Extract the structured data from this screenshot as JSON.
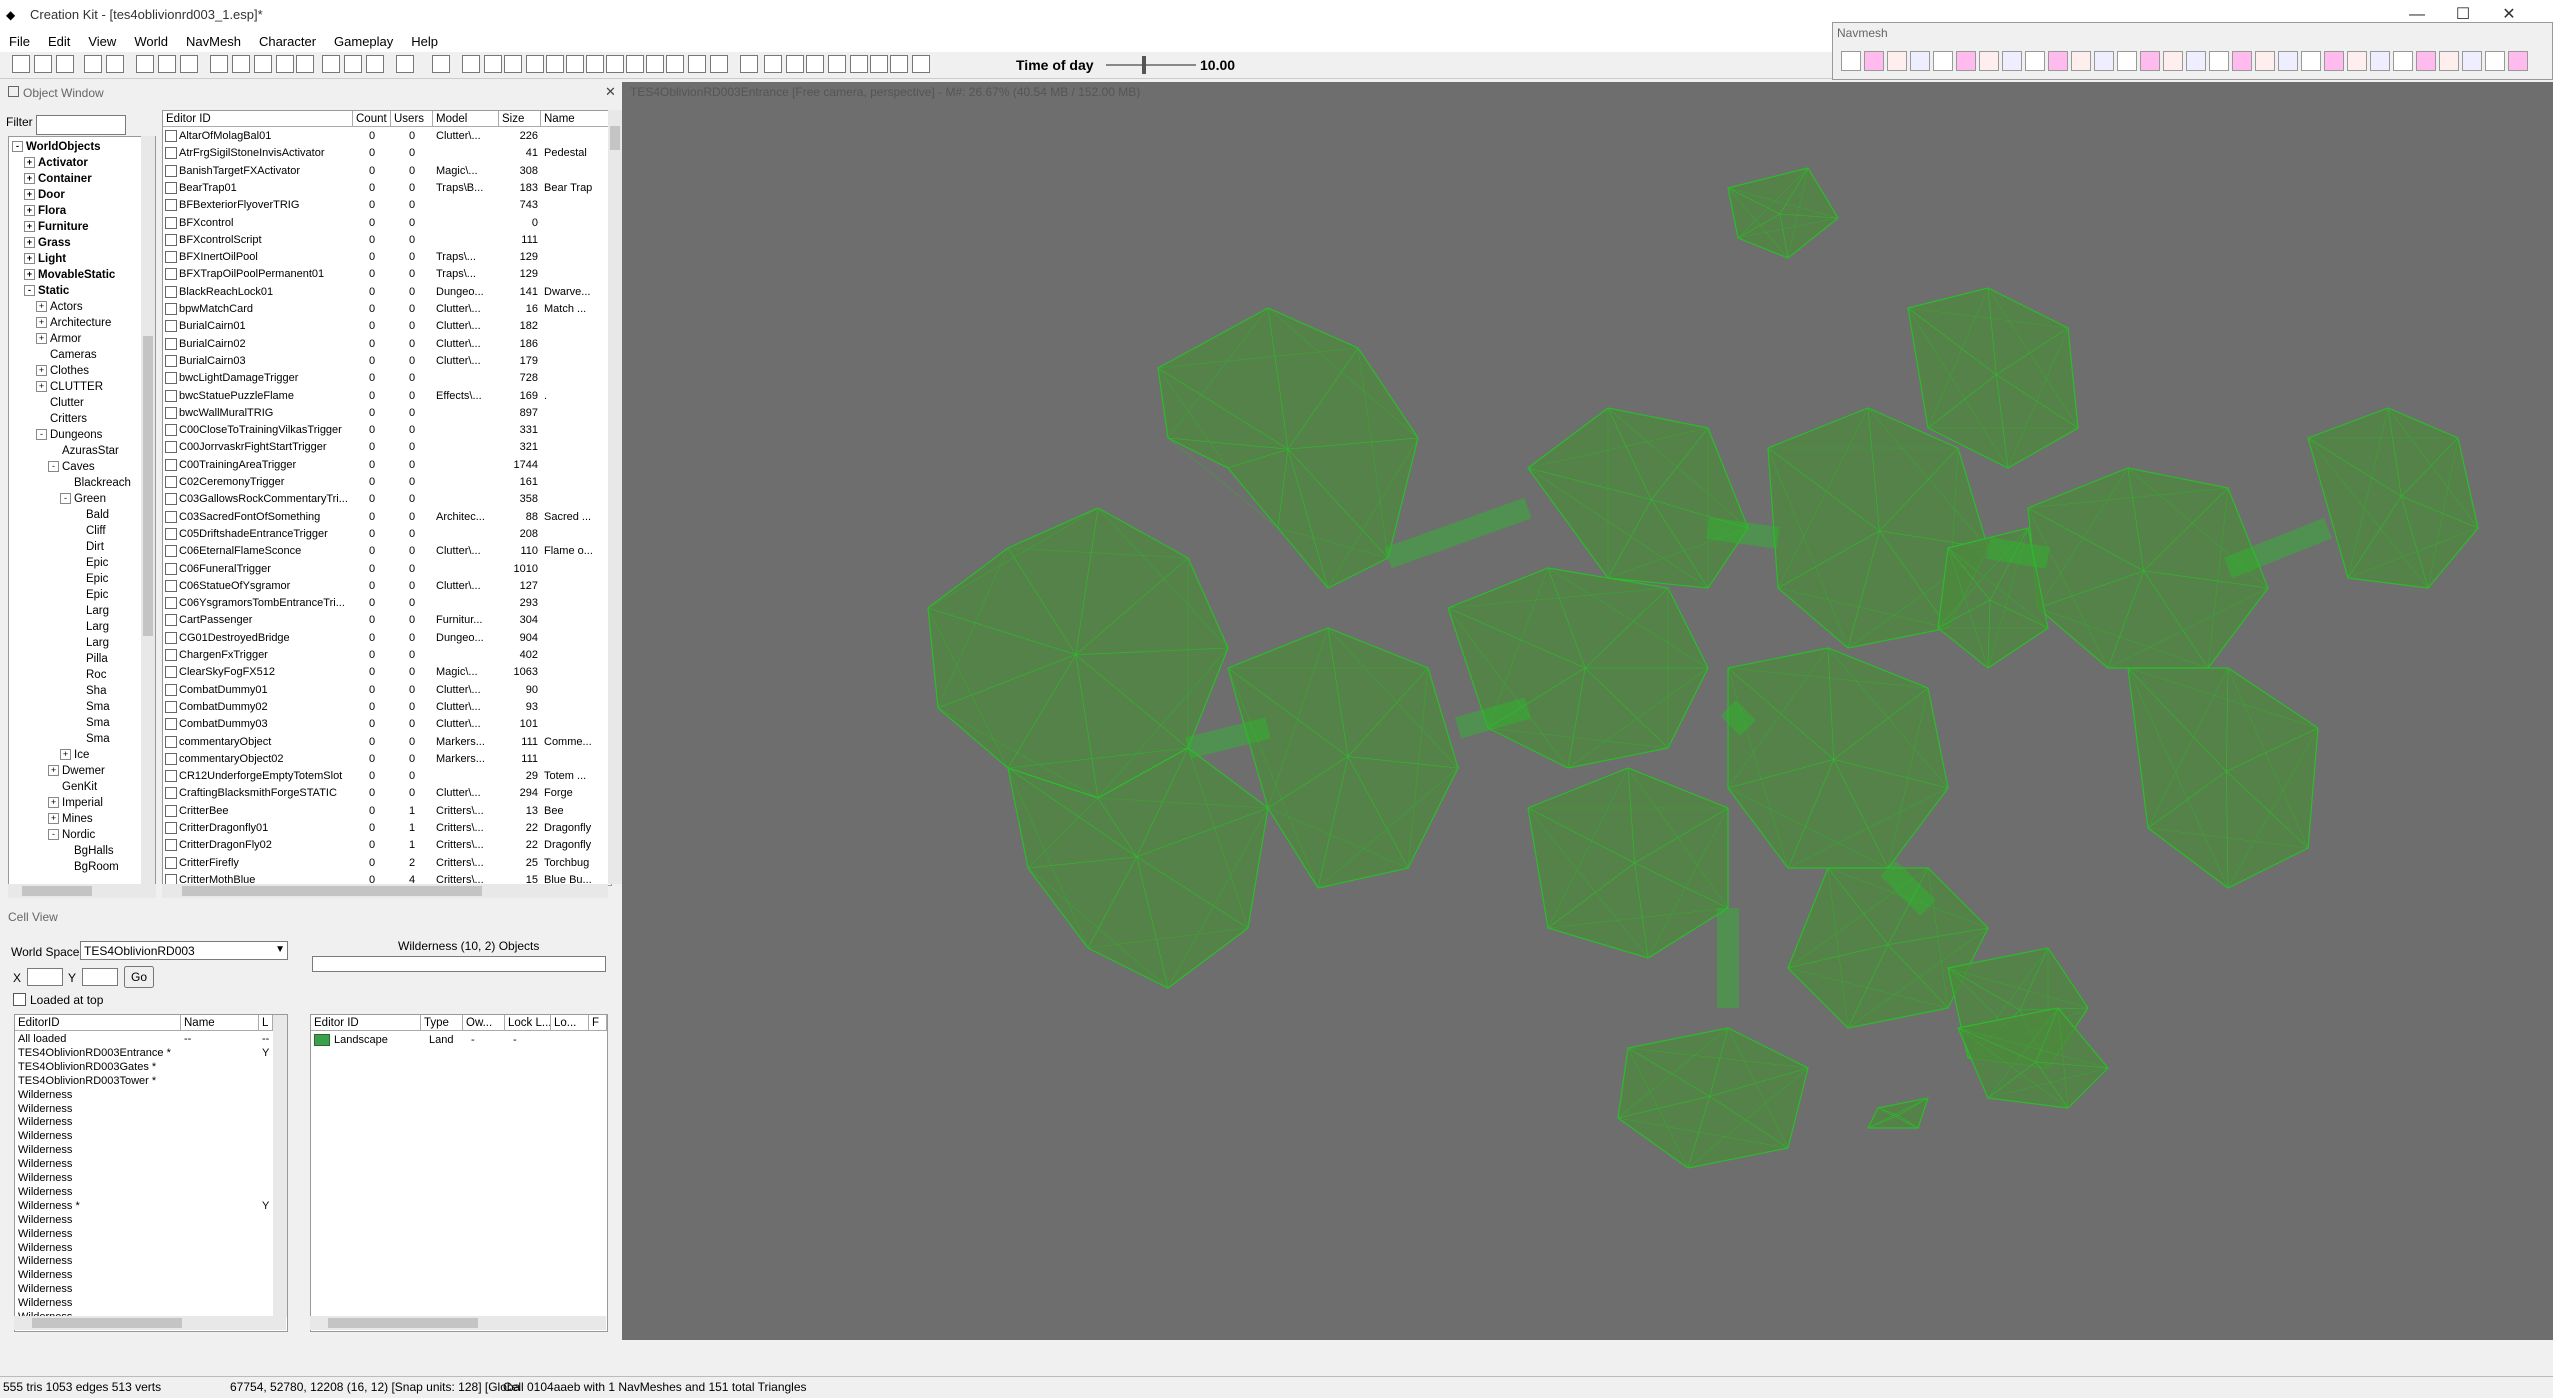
{
  "window": {
    "title": "Creation Kit - [tes4oblivionrd003_1.esp]*",
    "min": "—",
    "max": "☐",
    "close": "✕"
  },
  "menu": [
    "File",
    "Edit",
    "View",
    "World",
    "NavMesh",
    "Character",
    "Gameplay",
    "Help"
  ],
  "toolbar": {
    "time_label": "Time of day",
    "time_value": "10.00",
    "time_fraction": 0.42
  },
  "navmesh_window": {
    "title": "Navmesh"
  },
  "object_window": {
    "title": "Object Window",
    "close": "✕",
    "filter_label": "Filter",
    "tree": [
      {
        "label": "WorldObjects",
        "bold": true,
        "level": 0,
        "exp": "-"
      },
      {
        "label": "Activator",
        "bold": true,
        "level": 1,
        "exp": "+"
      },
      {
        "label": "Container",
        "bold": true,
        "level": 1,
        "exp": "+"
      },
      {
        "label": "Door",
        "bold": true,
        "level": 1,
        "exp": "+"
      },
      {
        "label": "Flora",
        "bold": true,
        "level": 1,
        "exp": "+"
      },
      {
        "label": "Furniture",
        "bold": true,
        "level": 1,
        "exp": "+"
      },
      {
        "label": "Grass",
        "bold": true,
        "level": 1,
        "exp": "+"
      },
      {
        "label": "Light",
        "bold": true,
        "level": 1,
        "exp": "+"
      },
      {
        "label": "MovableStatic",
        "bold": true,
        "level": 1,
        "exp": "+"
      },
      {
        "label": "Static",
        "bold": true,
        "level": 1,
        "exp": "-"
      },
      {
        "label": "Actors",
        "level": 2,
        "exp": "+"
      },
      {
        "label": "Architecture",
        "level": 2,
        "exp": "+"
      },
      {
        "label": "Armor",
        "level": 2,
        "exp": "+"
      },
      {
        "label": "Cameras",
        "level": 2,
        "exp": ""
      },
      {
        "label": "Clothes",
        "level": 2,
        "exp": "+"
      },
      {
        "label": "CLUTTER",
        "level": 2,
        "exp": "+"
      },
      {
        "label": "Clutter",
        "level": 2,
        "exp": ""
      },
      {
        "label": "Critters",
        "level": 2,
        "exp": ""
      },
      {
        "label": "Dungeons",
        "level": 2,
        "exp": "-"
      },
      {
        "label": "AzurasStar",
        "level": 3,
        "exp": ""
      },
      {
        "label": "Caves",
        "level": 3,
        "exp": "-"
      },
      {
        "label": "Blackreach",
        "level": 4,
        "exp": ""
      },
      {
        "label": "Green",
        "level": 4,
        "exp": "-"
      },
      {
        "label": "Bald",
        "level": 5,
        "exp": ""
      },
      {
        "label": "Cliff",
        "level": 5,
        "exp": ""
      },
      {
        "label": "Dirt",
        "level": 5,
        "exp": ""
      },
      {
        "label": "Epic",
        "level": 5,
        "exp": ""
      },
      {
        "label": "Epic",
        "level": 5,
        "exp": ""
      },
      {
        "label": "Epic",
        "level": 5,
        "exp": ""
      },
      {
        "label": "Larg",
        "level": 5,
        "exp": ""
      },
      {
        "label": "Larg",
        "level": 5,
        "exp": ""
      },
      {
        "label": "Larg",
        "level": 5,
        "exp": ""
      },
      {
        "label": "Pilla",
        "level": 5,
        "exp": ""
      },
      {
        "label": "Roc",
        "level": 5,
        "exp": ""
      },
      {
        "label": "Sha",
        "level": 5,
        "exp": ""
      },
      {
        "label": "Sma",
        "level": 5,
        "exp": ""
      },
      {
        "label": "Sma",
        "level": 5,
        "exp": ""
      },
      {
        "label": "Sma",
        "level": 5,
        "exp": ""
      },
      {
        "label": "Ice",
        "level": 4,
        "exp": "+"
      },
      {
        "label": "Dwemer",
        "level": 3,
        "exp": "+"
      },
      {
        "label": "GenKit",
        "level": 3,
        "exp": ""
      },
      {
        "label": "Imperial",
        "level": 3,
        "exp": "+"
      },
      {
        "label": "Mines",
        "level": 3,
        "exp": "+"
      },
      {
        "label": "Nordic",
        "level": 3,
        "exp": "-"
      },
      {
        "label": "BgHalls",
        "level": 4,
        "exp": ""
      },
      {
        "label": "BgRoom",
        "level": 4,
        "exp": ""
      }
    ],
    "columns": [
      "Editor ID",
      "Count",
      "Users",
      "Model",
      "Size",
      "Name"
    ],
    "rows": [
      [
        "AltarOfMolagBal01",
        "0",
        "0",
        "Clutter\\...",
        "226",
        ""
      ],
      [
        "AtrFrgSigilStoneInvisActivator",
        "0",
        "0",
        "",
        "41",
        "Pedestal"
      ],
      [
        "BanishTargetFXActivator",
        "0",
        "0",
        "Magic\\...",
        "308",
        ""
      ],
      [
        "BearTrap01",
        "0",
        "0",
        "Traps\\B...",
        "183",
        "Bear Trap"
      ],
      [
        "BFBexteriorFlyoverTRIG",
        "0",
        "0",
        "",
        "743",
        ""
      ],
      [
        "BFXcontrol",
        "0",
        "0",
        "",
        "0",
        ""
      ],
      [
        "BFXcontrolScript",
        "0",
        "0",
        "",
        "111",
        ""
      ],
      [
        "BFXInertOilPool",
        "0",
        "0",
        "Traps\\...",
        "129",
        ""
      ],
      [
        "BFXTrapOilPoolPermanent01",
        "0",
        "0",
        "Traps\\...",
        "129",
        ""
      ],
      [
        "BlackReachLock01",
        "0",
        "0",
        "Dungeo...",
        "141",
        "Dwarve..."
      ],
      [
        "bpwMatchCard",
        "0",
        "0",
        "Clutter\\...",
        "16",
        "Match ..."
      ],
      [
        "BurialCairn01",
        "0",
        "0",
        "Clutter\\...",
        "182",
        ""
      ],
      [
        "BurialCairn02",
        "0",
        "0",
        "Clutter\\...",
        "186",
        ""
      ],
      [
        "BurialCairn03",
        "0",
        "0",
        "Clutter\\...",
        "179",
        ""
      ],
      [
        "bwcLightDamageTrigger",
        "0",
        "0",
        "",
        "728",
        ""
      ],
      [
        "bwcStatuePuzzleFlame",
        "0",
        "0",
        "Effects\\...",
        "169",
        "."
      ],
      [
        "bwcWallMuralTRIG",
        "0",
        "0",
        "",
        "897",
        ""
      ],
      [
        "C00CloseToTrainingVilkasTrigger",
        "0",
        "0",
        "",
        "331",
        ""
      ],
      [
        "C00JorrvaskrFightStartTrigger",
        "0",
        "0",
        "",
        "321",
        ""
      ],
      [
        "C00TrainingAreaTrigger",
        "0",
        "0",
        "",
        "1744",
        ""
      ],
      [
        "C02CeremonyTrigger",
        "0",
        "0",
        "",
        "161",
        ""
      ],
      [
        "C03GallowsRockCommentaryTri...",
        "0",
        "0",
        "",
        "358",
        ""
      ],
      [
        "C03SacredFontOfSomething",
        "0",
        "0",
        "Architec...",
        "88",
        "Sacred ..."
      ],
      [
        "C05DriftshadeEntranceTrigger",
        "0",
        "0",
        "",
        "208",
        ""
      ],
      [
        "C06EternalFlameSconce",
        "0",
        "0",
        "Clutter\\...",
        "110",
        "Flame o..."
      ],
      [
        "C06FuneralTrigger",
        "0",
        "0",
        "",
        "1010",
        ""
      ],
      [
        "C06StatueOfYsgramor",
        "0",
        "0",
        "Clutter\\...",
        "127",
        ""
      ],
      [
        "C06YsgramorsTombEntranceTri...",
        "0",
        "0",
        "",
        "293",
        ""
      ],
      [
        "CartPassenger",
        "0",
        "0",
        "Furnitur...",
        "304",
        ""
      ],
      [
        "CG01DestroyedBridge",
        "0",
        "0",
        "Dungeo...",
        "904",
        ""
      ],
      [
        "ChargenFxTrigger",
        "0",
        "0",
        "",
        "402",
        ""
      ],
      [
        "ClearSkyFogFX512",
        "0",
        "0",
        "Magic\\...",
        "1063",
        ""
      ],
      [
        "CombatDummy01",
        "0",
        "0",
        "Clutter\\...",
        "90",
        ""
      ],
      [
        "CombatDummy02",
        "0",
        "0",
        "Clutter\\...",
        "93",
        ""
      ],
      [
        "CombatDummy03",
        "0",
        "0",
        "Clutter\\...",
        "101",
        ""
      ],
      [
        "commentaryObject",
        "0",
        "0",
        "Markers...",
        "111",
        "Comme..."
      ],
      [
        "commentaryObject02",
        "0",
        "0",
        "Markers...",
        "111",
        ""
      ],
      [
        "CR12UnderforgeEmptyTotemSlot",
        "0",
        "0",
        "",
        "29",
        "Totem ..."
      ],
      [
        "CraftingBlacksmithForgeSTATIC",
        "0",
        "0",
        "Clutter\\...",
        "294",
        "Forge"
      ],
      [
        "CritterBee",
        "0",
        "1",
        "Critters\\...",
        "13",
        "Bee"
      ],
      [
        "CritterDragonfly01",
        "0",
        "1",
        "Critters\\...",
        "22",
        "Dragonfly"
      ],
      [
        "CritterDragonFly02",
        "0",
        "1",
        "Critters\\...",
        "22",
        "Dragonfly"
      ],
      [
        "CritterFirefly",
        "0",
        "2",
        "Critters\\...",
        "25",
        "Torchbug"
      ],
      [
        "CritterMothBlue",
        "0",
        "4",
        "Critters\\...",
        "15",
        "Blue Bu..."
      ]
    ]
  },
  "cell_view": {
    "title": "Cell View",
    "world_space_label": "World Space",
    "world_space_value": "TES4OblivionRD003",
    "objects_caption": "Wilderness (10, 2) Objects",
    "x_label": "X",
    "y_label": "Y",
    "go_label": "Go",
    "loaded_at_top": "Loaded at top",
    "cell_columns": [
      "EditorID",
      "Name",
      "L"
    ],
    "cells": [
      [
        "All loaded",
        "--",
        "--"
      ],
      [
        "TES4OblivionRD003Entrance *",
        "",
        "Y"
      ],
      [
        "TES4OblivionRD003Gates *",
        "",
        ""
      ],
      [
        "TES4OblivionRD003Tower *",
        "",
        ""
      ],
      [
        "Wilderness",
        "",
        ""
      ],
      [
        "Wilderness",
        "",
        ""
      ],
      [
        "Wilderness",
        "",
        ""
      ],
      [
        "Wilderness",
        "",
        ""
      ],
      [
        "Wilderness",
        "",
        ""
      ],
      [
        "Wilderness",
        "",
        ""
      ],
      [
        "Wilderness",
        "",
        ""
      ],
      [
        "Wilderness",
        "",
        ""
      ],
      [
        "Wilderness *",
        "",
        "Y"
      ],
      [
        "Wilderness",
        "",
        ""
      ],
      [
        "Wilderness",
        "",
        ""
      ],
      [
        "Wilderness",
        "",
        ""
      ],
      [
        "Wilderness",
        "",
        ""
      ],
      [
        "Wilderness",
        "",
        ""
      ],
      [
        "Wilderness",
        "",
        ""
      ],
      [
        "Wilderness",
        "",
        ""
      ],
      [
        "Wilderness",
        "",
        ""
      ]
    ],
    "obj_columns": [
      "Editor ID",
      "Type",
      "Ow...",
      "Lock L...",
      "Lo...",
      "F"
    ],
    "objects": [
      [
        "Landscape",
        "Land",
        "-",
        "-",
        "",
        ""
      ]
    ]
  },
  "render": {
    "title": "TES4OblivionRD003Entrance [Free camera, perspective] - M#: 26.67% (40.54 MB / 152.00 MB)"
  },
  "status": {
    "s1": "555 tris 1053 edges 513 verts",
    "s2": "67754, 52780, 12208 (16, 12) [Snap units: 128] [Globa",
    "s3": "Cell 0104aaeb with 1 NavMeshes and 151 total Triangles"
  },
  "colors": {
    "mesh_fill": "#4c8a3c",
    "mesh_edge": "#2dbb2d",
    "viewport_bg": "#6e6e6e"
  }
}
